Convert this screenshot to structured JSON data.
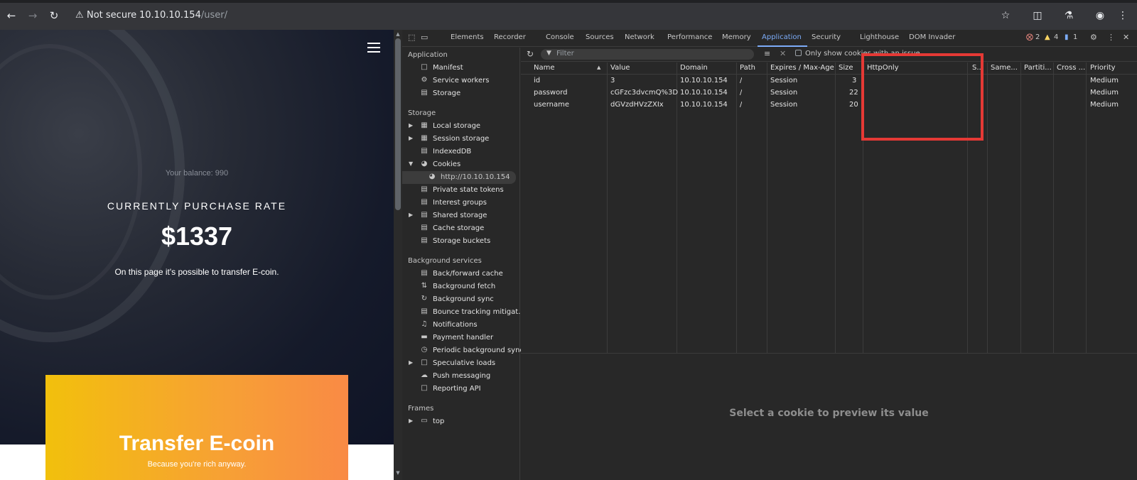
{
  "browser": {
    "security_label": "Not secure",
    "url_host": "10.10.10.154",
    "url_path": "/user/"
  },
  "page": {
    "balance": "Your balance: 990",
    "rate_label": "CURRENTLY PURCHASE RATE",
    "rate_value": "$1337",
    "description": "On this page it's possible to transfer E-coin.",
    "transfer_title": "Transfer E-coin",
    "transfer_subtitle": "Because you're rich anyway."
  },
  "devtools": {
    "tabs": [
      "Elements",
      "Recorder",
      "Console",
      "Sources",
      "Network",
      "Performance",
      "Memory",
      "Application",
      "Security",
      "Lighthouse",
      "DOM Invader"
    ],
    "active_tab": "Application",
    "errors": "2",
    "warnings": "4",
    "messages": "1",
    "sidebar": {
      "application_header": "Application",
      "application_items": [
        "Manifest",
        "Service workers",
        "Storage"
      ],
      "storage_header": "Storage",
      "storage_items": [
        "Local storage",
        "Session storage",
        "IndexedDB",
        "Cookies",
        "http://10.10.10.154",
        "Private state tokens",
        "Interest groups",
        "Shared storage",
        "Cache storage",
        "Storage buckets"
      ],
      "background_header": "Background services",
      "background_items": [
        "Back/forward cache",
        "Background fetch",
        "Background sync",
        "Bounce tracking mitigat...",
        "Notifications",
        "Payment handler",
        "Periodic background sync",
        "Speculative loads",
        "Push messaging",
        "Reporting API"
      ],
      "frames_header": "Frames",
      "frames_items": [
        "top"
      ]
    },
    "filter_placeholder": "Filter",
    "only_show_label": "Only show cookies with an issue",
    "columns": [
      "Name",
      "Value",
      "Domain",
      "Path",
      "Expires / Max-Age",
      "Size",
      "HttpOnly",
      "S...",
      "Same...",
      "Partiti...",
      "Cross ...",
      "Priority"
    ],
    "cookies": [
      {
        "name": "id",
        "value": "3",
        "domain": "10.10.10.154",
        "path": "/",
        "expires": "Session",
        "size": "3",
        "priority": "Medium"
      },
      {
        "name": "password",
        "value": "cGFzc3dvcmQ%3D",
        "domain": "10.10.10.154",
        "path": "/",
        "expires": "Session",
        "size": "22",
        "priority": "Medium"
      },
      {
        "name": "username",
        "value": "dGVzdHVzZXIx",
        "domain": "10.10.10.154",
        "path": "/",
        "expires": "Session",
        "size": "20",
        "priority": "Medium"
      }
    ],
    "preview_message": "Select a cookie to preview its value"
  },
  "colors": {
    "accent": "#7cacf8",
    "highlight": "#e53935",
    "card_start": "#f2c00c",
    "card_end": "#f98a45"
  }
}
